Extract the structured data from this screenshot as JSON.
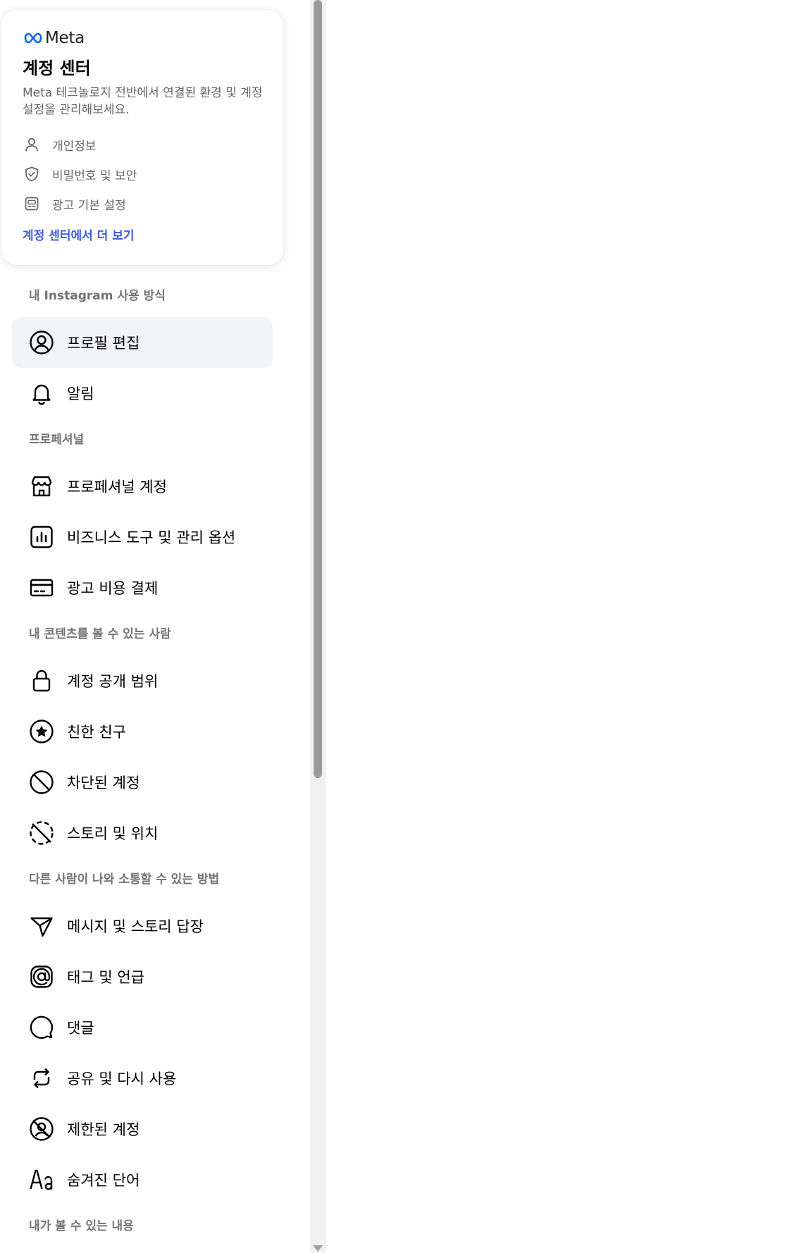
{
  "accounts_center": {
    "logo_text": "Meta",
    "title": "계정 센터",
    "description": "Meta 테크놀로지 전반에서 연결된 환경 및 계정 설정을 관리해보세요.",
    "links": [
      {
        "label": "개인정보",
        "icon": "person-icon"
      },
      {
        "label": "비밀번호 및 보안",
        "icon": "shield-check-icon"
      },
      {
        "label": "광고 기본 설정",
        "icon": "ad-settings-icon"
      }
    ],
    "more_link": "계정 센터에서 더 보기",
    "link_color": "#3b5bdb"
  },
  "sections": [
    {
      "header": "내 Instagram 사용 방식",
      "items": [
        {
          "label": "프로필 편집",
          "icon": "profile-circle-icon",
          "active": true
        },
        {
          "label": "알림",
          "icon": "bell-icon"
        }
      ]
    },
    {
      "header": "프로페셔널",
      "items": [
        {
          "label": "프로페셔널 계정",
          "icon": "shop-icon"
        },
        {
          "label": "비즈니스 도구 및 관리 옵션",
          "icon": "bar-chart-icon"
        },
        {
          "label": "광고 비용 결제",
          "icon": "credit-card-icon"
        }
      ]
    },
    {
      "header": "내 콘텐츠를 볼 수 있는 사람",
      "items": [
        {
          "label": "계정 공개 범위",
          "icon": "lock-icon"
        },
        {
          "label": "친한 친구",
          "icon": "star-circle-icon"
        },
        {
          "label": "차단된 계정",
          "icon": "block-icon"
        },
        {
          "label": "스토리 및 위치",
          "icon": "story-off-icon"
        }
      ]
    },
    {
      "header": "다른 사람이 나와 소통할 수 있는 방법",
      "items": [
        {
          "label": "메시지 및 스토리 답장",
          "icon": "send-icon"
        },
        {
          "label": "태그 및 언급",
          "icon": "at-sign-icon"
        },
        {
          "label": "댓글",
          "icon": "comment-icon"
        },
        {
          "label": "공유 및 다시 사용",
          "icon": "repost-icon"
        },
        {
          "label": "제한된 계정",
          "icon": "restricted-icon"
        },
        {
          "label": "숨겨진 단어",
          "icon": "text-aa-icon"
        }
      ]
    },
    {
      "header": "내가 볼 수 있는 내용",
      "items": []
    }
  ]
}
